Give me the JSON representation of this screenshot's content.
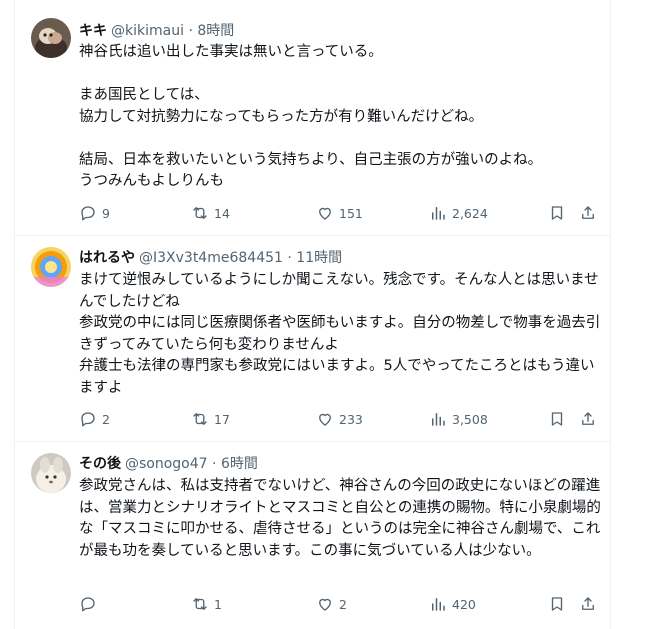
{
  "tweets": [
    {
      "name": "キキ",
      "handle": "@kikimaui",
      "sep": "·",
      "time": "8時間",
      "lines": [
        "神谷氏は追い出した事実は無いと言っている。",
        "まあ国民としては、\n協力して対抗勢力になってもらった方が有り難いんだけどね。",
        "結局、日本を救いたいという気持ちより、自己主張の方が強いのよね。\nうつみんもよしりんも"
      ],
      "replies": "9",
      "reposts": "14",
      "likes": "151",
      "views": "2,624"
    },
    {
      "name": "はれるや",
      "handle": "@I3Xv3t4me684451",
      "sep": "·",
      "time": "11時間",
      "lines": [
        "まけて逆恨みしているようにしか聞こえない。残念です。そんな人とは思いませんでしたけどね\n参政党の中には同じ医療関係者や医師もいますよ。自分の物差しで物事を過去引きずってみていたら何も変わりませんよ\n弁護士も法律の専門家も参政党にはいますよ。5人でやってたころとはもう違いますよ"
      ],
      "replies": "2",
      "reposts": "17",
      "likes": "233",
      "views": "3,508"
    },
    {
      "name": "その後",
      "handle": "@sonogo47",
      "sep": "·",
      "time": "6時間",
      "lines": [
        "参政党さんは、私は支持者でないけど、神谷さんの今回の政史にないほどの躍進は、営業力とシナリオライトとマスコミと自公との連携の賜物。特に小泉劇場的な「マスコミに叩かせる、虐待させる」というのは完全に神谷さん劇場で、これが最も功を奏していると思います。この事に気づいている人は少ない。"
      ],
      "replies": "",
      "reposts": "1",
      "likes": "2",
      "views": "420"
    }
  ],
  "icons": {
    "reply": "reply-icon",
    "repost": "repost-icon",
    "like": "like-icon",
    "views": "views-icon",
    "bookmark": "bookmark-icon",
    "share": "share-icon"
  },
  "colors": {
    "secondary": "#536471",
    "text": "#0f1419",
    "border": "#eff3f4"
  }
}
